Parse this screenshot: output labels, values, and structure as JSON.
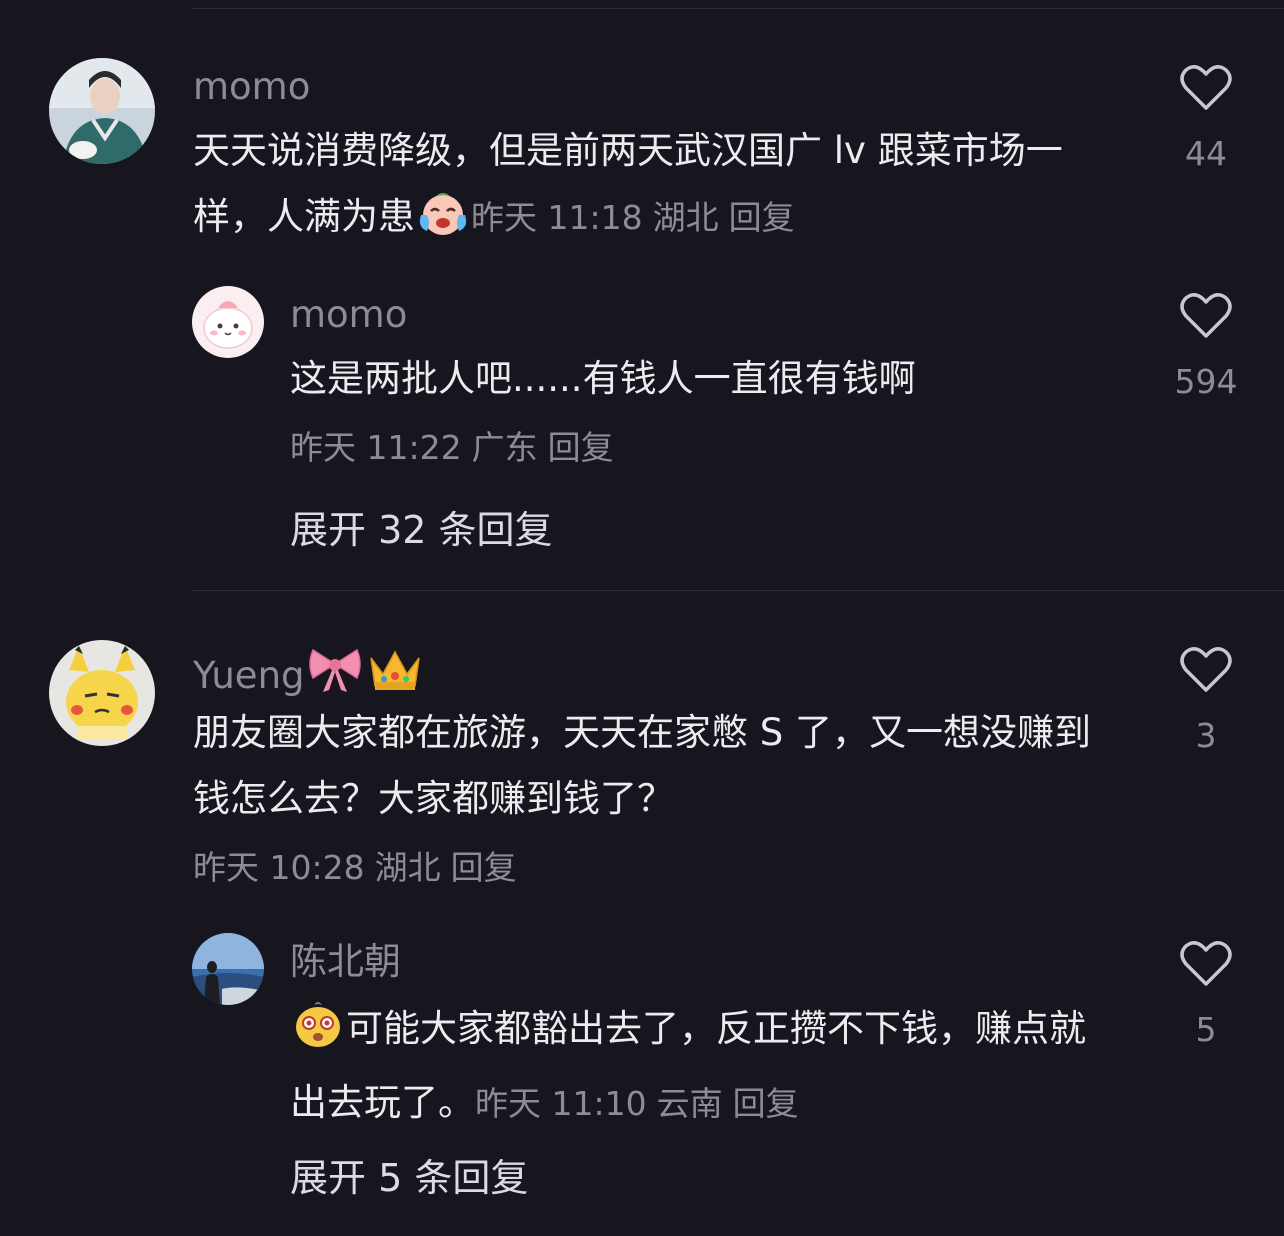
{
  "comments": [
    {
      "username": "momo",
      "text": "天天说消费降级，但是前两天武汉国广 lv 跟菜市场一样，人满为患",
      "emoji": "crying-laughing-face-icon",
      "time": "昨天 11:18",
      "location": "湖北",
      "reply_label": "回复",
      "likes": "44",
      "replies": [
        {
          "username": "momo",
          "text": "这是两批人吧......有钱人一直很有钱啊",
          "time": "昨天 11:22",
          "location": "广东",
          "reply_label": "回复",
          "likes": "594"
        }
      ],
      "expand_label": "展开 32 条回复"
    },
    {
      "username": "Yueng",
      "username_emojis": [
        "ribbon-icon",
        "crown-icon"
      ],
      "text": "朋友圈大家都在旅游，天天在家憋 S 了，又一想没赚到钱怎么去？大家都赚到钱了？",
      "time": "昨天 10:28",
      "location": "湖北",
      "reply_label": "回复",
      "likes": "3",
      "replies": [
        {
          "username": "陈北朝",
          "emoji": "shocked-face-icon",
          "text": "可能大家都豁出去了，反正攒不下钱，赚点就出去玩了。",
          "time": "昨天 11:10",
          "location": "云南",
          "reply_label": "回复",
          "likes": "5"
        }
      ],
      "expand_label": "展开 5 条回复"
    }
  ],
  "colors": {
    "background": "#17161e",
    "text": "#ecebf0",
    "muted": "#8d8c94",
    "divider": "#2c2b33"
  }
}
